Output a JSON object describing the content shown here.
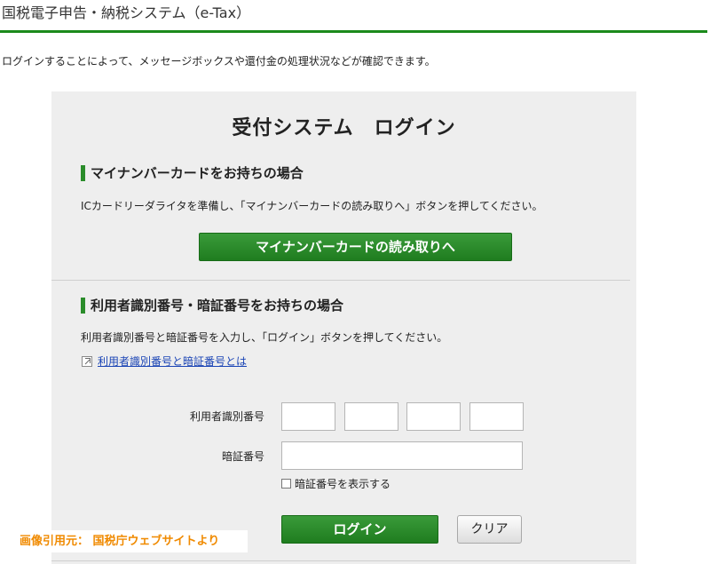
{
  "header": {
    "site_title": "国税電子申告・納税システム（e-Tax）",
    "intro": "ログインすることによって、メッセージボックスや還付金の処理状況などが確認できます。"
  },
  "login_panel": {
    "title": "受付システム　ログイン",
    "mynumber_section": {
      "heading": "マイナンバーカードをお持ちの場合",
      "description": "ICカードリーダライタを準備し、「マイナンバーカードの読み取りへ」ボタンを押してください。",
      "button_label": "マイナンバーカードの読み取りへ"
    },
    "id_section": {
      "heading": "利用者識別番号・暗証番号をお持ちの場合",
      "description": "利用者識別番号と暗証番号を入力し、「ログイン」ボタンを押してください。",
      "help_link": "利用者識別番号と暗証番号とは",
      "user_id_label": "利用者識別番号",
      "user_id_values": [
        "",
        "",
        "",
        ""
      ],
      "password_label": "暗証番号",
      "password_value": "",
      "show_password_label": "暗証番号を表示する",
      "show_password_checked": false,
      "login_button": "ログイン",
      "clear_button": "クリア"
    }
  },
  "watermark": "画像引用元： 国税庁ウェブサイトより",
  "colors": {
    "brand_green": "#1b8a1b",
    "button_green": "#2a8c2a",
    "link_blue": "#1a44b5",
    "panel_bg": "#eeeeee",
    "watermark_orange": "#f08a00"
  },
  "icons": {
    "help_link_icon": "external-link-icon"
  }
}
